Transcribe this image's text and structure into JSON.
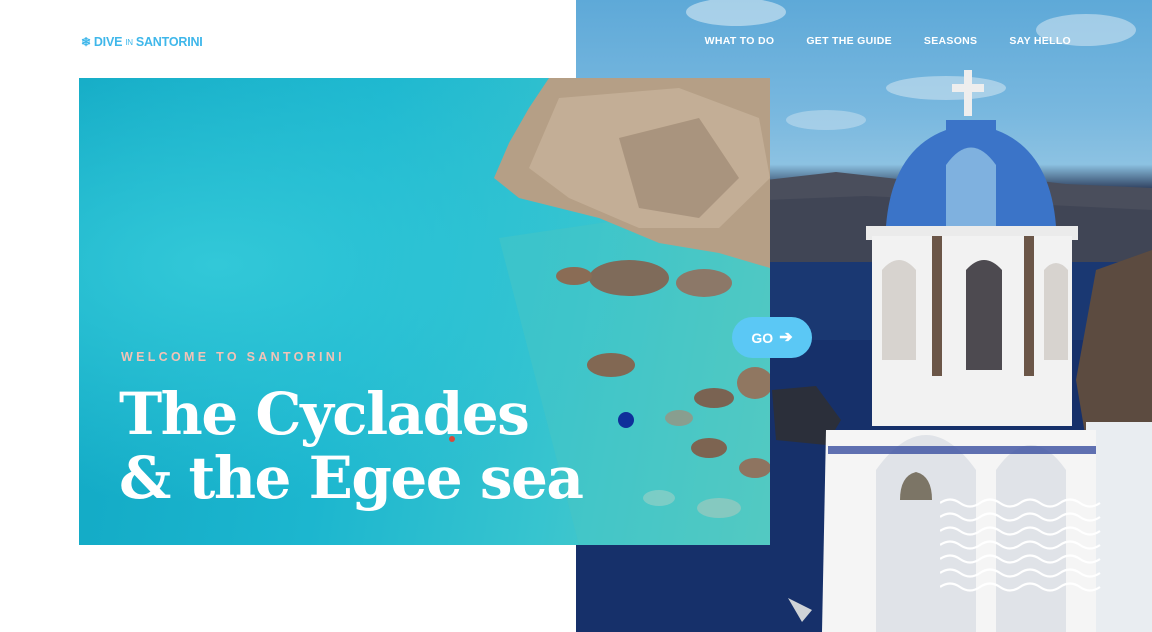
{
  "brand": {
    "logo_pre": "DIVE",
    "logo_mid": "IN",
    "logo_post": "SANTORINI"
  },
  "nav": {
    "items": [
      {
        "label": "WHAT TO DO"
      },
      {
        "label": "GET THE GUIDE"
      },
      {
        "label": "SEASONS"
      },
      {
        "label": "SAY HELLO"
      }
    ]
  },
  "hero": {
    "eyebrow": "WELCOME TO SANTORINI",
    "title_line1": "The Cyclades",
    "title_line2": "& the Egee sea",
    "cta_label": "GO",
    "cta_icon": "arrow-right-icon"
  },
  "colors": {
    "accent": "#3fb7ea",
    "cta": "#5bc8f5",
    "eyebrow": "#f3c3b7",
    "dot": "#0f2f9a",
    "dome": "#3b74c8"
  }
}
